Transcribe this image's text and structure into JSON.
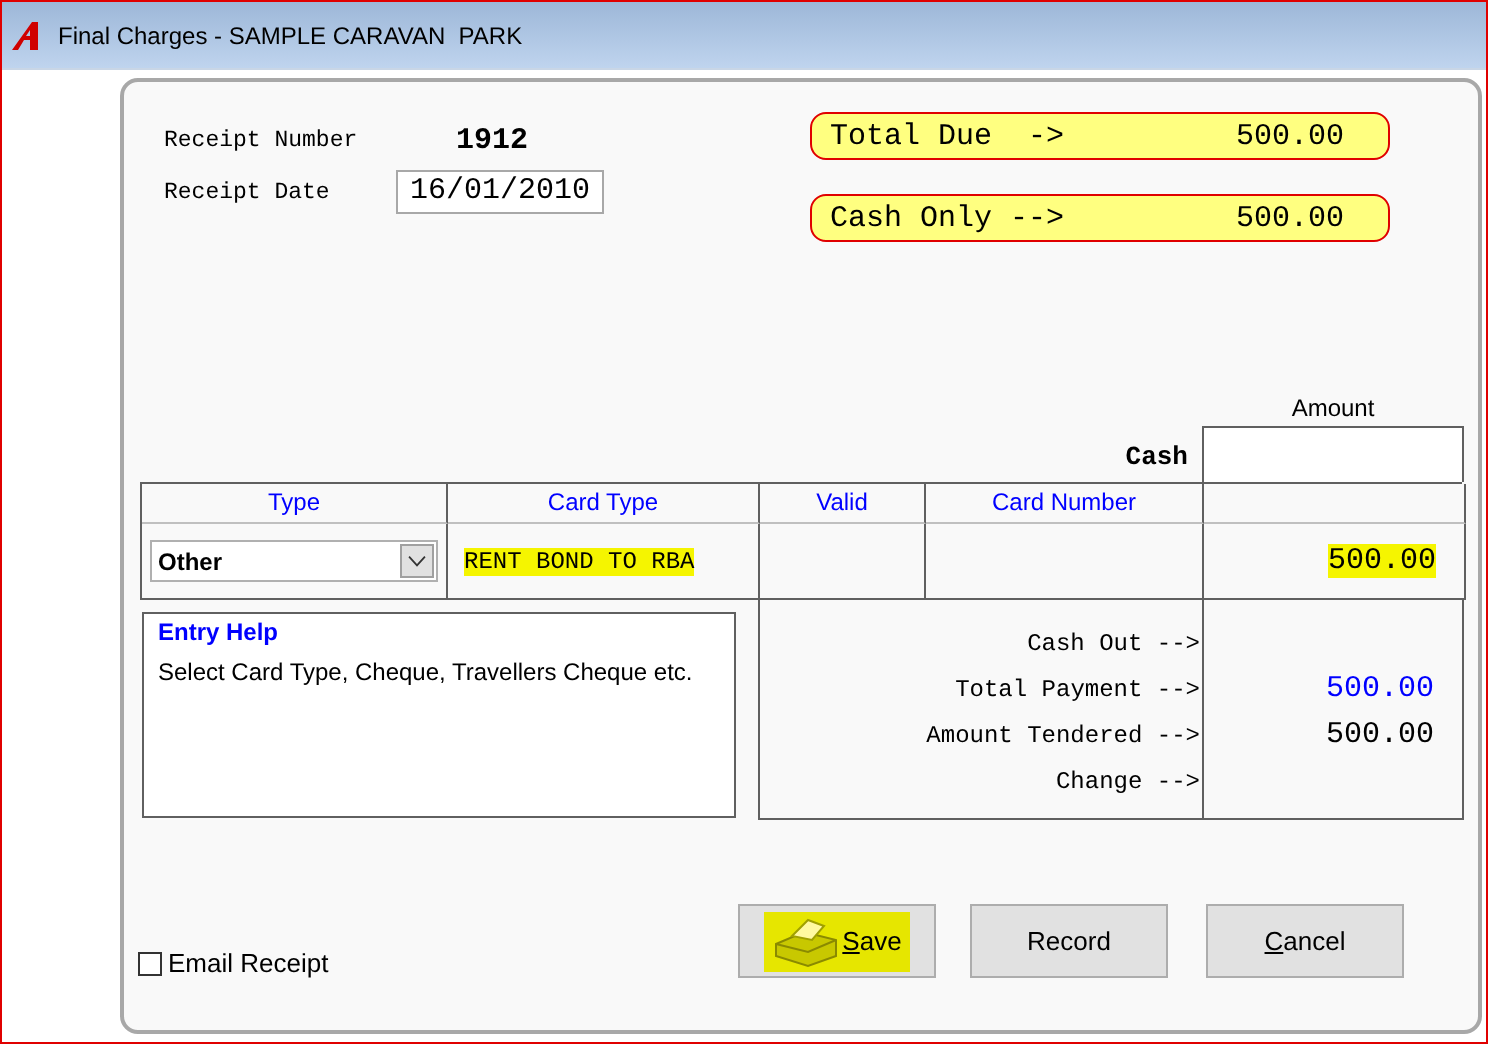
{
  "window": {
    "title": "Final Charges - SAMPLE CARAVAN  PARK"
  },
  "receipt": {
    "number_label": "Receipt Number",
    "number": "1912",
    "date_label": "Receipt Date",
    "date": "16/01/2010"
  },
  "totals": [
    {
      "label": "Total Due  ->",
      "value": "500.00"
    },
    {
      "label": "Cash Only -->",
      "value": "500.00"
    }
  ],
  "amount_header": "Amount",
  "cash_label": "Cash",
  "table": {
    "columns": [
      "Type",
      "Card Type",
      "Valid",
      "Card Number"
    ],
    "rows": [
      {
        "type": "Other",
        "card_type": "RENT BOND TO RBA",
        "card_type_highlighted": true,
        "amount": "500.00",
        "amount_highlighted": true
      }
    ]
  },
  "entry_help": {
    "title": "Entry Help",
    "text": "Select Card Type, Cheque, Travellers Cheque etc."
  },
  "summary": [
    {
      "label": "Cash Out -->"
    },
    {
      "label": "Total Payment -->",
      "value": "500.00",
      "color": "#0000ff"
    },
    {
      "label": "Amount Tendered -->",
      "value": "500.00",
      "color": "#000000"
    },
    {
      "label": "Change -->"
    }
  ],
  "email_receipt": {
    "label": "Email Receipt",
    "checked": false
  },
  "buttons": [
    {
      "label": "Save",
      "kind": "print",
      "underline_first": true,
      "highlighted": true
    },
    {
      "label": "Record",
      "kind": "plain",
      "underline_first": false,
      "highlighted": false
    },
    {
      "label": "Cancel",
      "kind": "plain",
      "underline_first": true,
      "highlighted": false
    }
  ]
}
